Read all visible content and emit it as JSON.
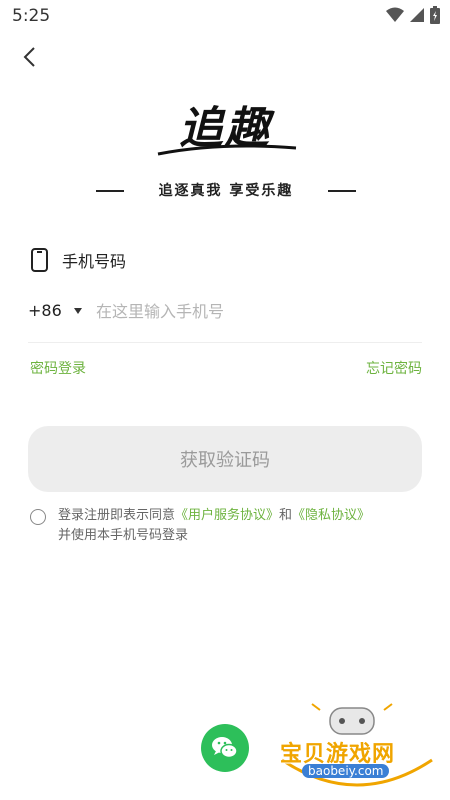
{
  "status_bar": {
    "time": "5:25"
  },
  "header": {
    "logo_text": "追趣",
    "slogan": "追逐真我  享受乐趣"
  },
  "form": {
    "phone_label": "手机号码",
    "country_code": "+86",
    "phone_placeholder": "在这里输入手机号",
    "password_login": "密码登录",
    "forgot_password": "忘记密码",
    "get_code_button": "获取验证码"
  },
  "agreement": {
    "prefix": "登录注册即表示同意",
    "user_agreement": "《用户服务协议》",
    "and": "和",
    "privacy_agreement": "《隐私协议》",
    "suffix": "并使用本手机号码登录"
  },
  "watermark": {
    "name": "宝贝游戏网",
    "url": "baobeiy.com"
  },
  "colors": {
    "accent": "#6db33f",
    "wechat": "#2dbf5a",
    "button_bg": "#ededed"
  }
}
